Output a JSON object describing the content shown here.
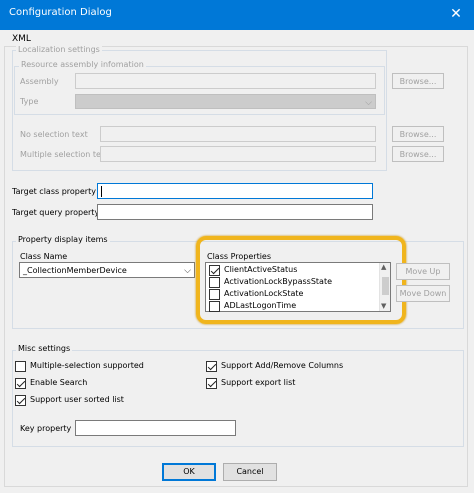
{
  "window": {
    "title": "Configuration Dialog",
    "close_glyph": "✕"
  },
  "tab": {
    "label": "XML"
  },
  "localization": {
    "legend": "Localization settings",
    "resource": {
      "legend": "Resource assembly infomation",
      "assembly_label": "Assembly",
      "assembly_value": "",
      "browse_label": "Browse...",
      "type_label": "Type",
      "type_value": ""
    },
    "no_selection_label": "No selection text",
    "no_selection_value": "",
    "no_selection_browse": "Browse...",
    "multi_selection_label": "Multiple selection text",
    "multi_selection_value": "",
    "multi_selection_browse": "Browse..."
  },
  "target_class": {
    "label": "Target class property",
    "value": ""
  },
  "target_query": {
    "label": "Target query property",
    "value": ""
  },
  "property_display": {
    "legend": "Property display items",
    "class_name_label": "Class Name",
    "class_name_value": "_CollectionMemberDevice",
    "class_properties_label": "Class Properties",
    "items": [
      {
        "label": "ClientActiveStatus",
        "checked": true
      },
      {
        "label": "ActivationLockBypassState",
        "checked": false
      },
      {
        "label": "ActivationLockState",
        "checked": false
      },
      {
        "label": "ADLastLogonTime",
        "checked": false
      }
    ],
    "move_up_label": "Move Up",
    "move_down_label": "Move Down"
  },
  "misc": {
    "legend": "Misc settings",
    "multi_selection_supported": {
      "label": "Multiple-selection supported",
      "checked": false
    },
    "enable_search": {
      "label": "Enable Search",
      "checked": true
    },
    "user_sorted_list": {
      "label": "Support user sorted list",
      "checked": true
    },
    "add_remove_columns": {
      "label": "Support Add/Remove Columns",
      "checked": true
    },
    "export_list": {
      "label": "Support export list",
      "checked": true
    },
    "key_property_label": "Key property",
    "key_property_value": ""
  },
  "footer": {
    "ok_label": "OK",
    "cancel_label": "Cancel"
  },
  "colors": {
    "titlebar": "#0078d7",
    "highlight": "#f0b51d",
    "focus": "#0078d7"
  }
}
